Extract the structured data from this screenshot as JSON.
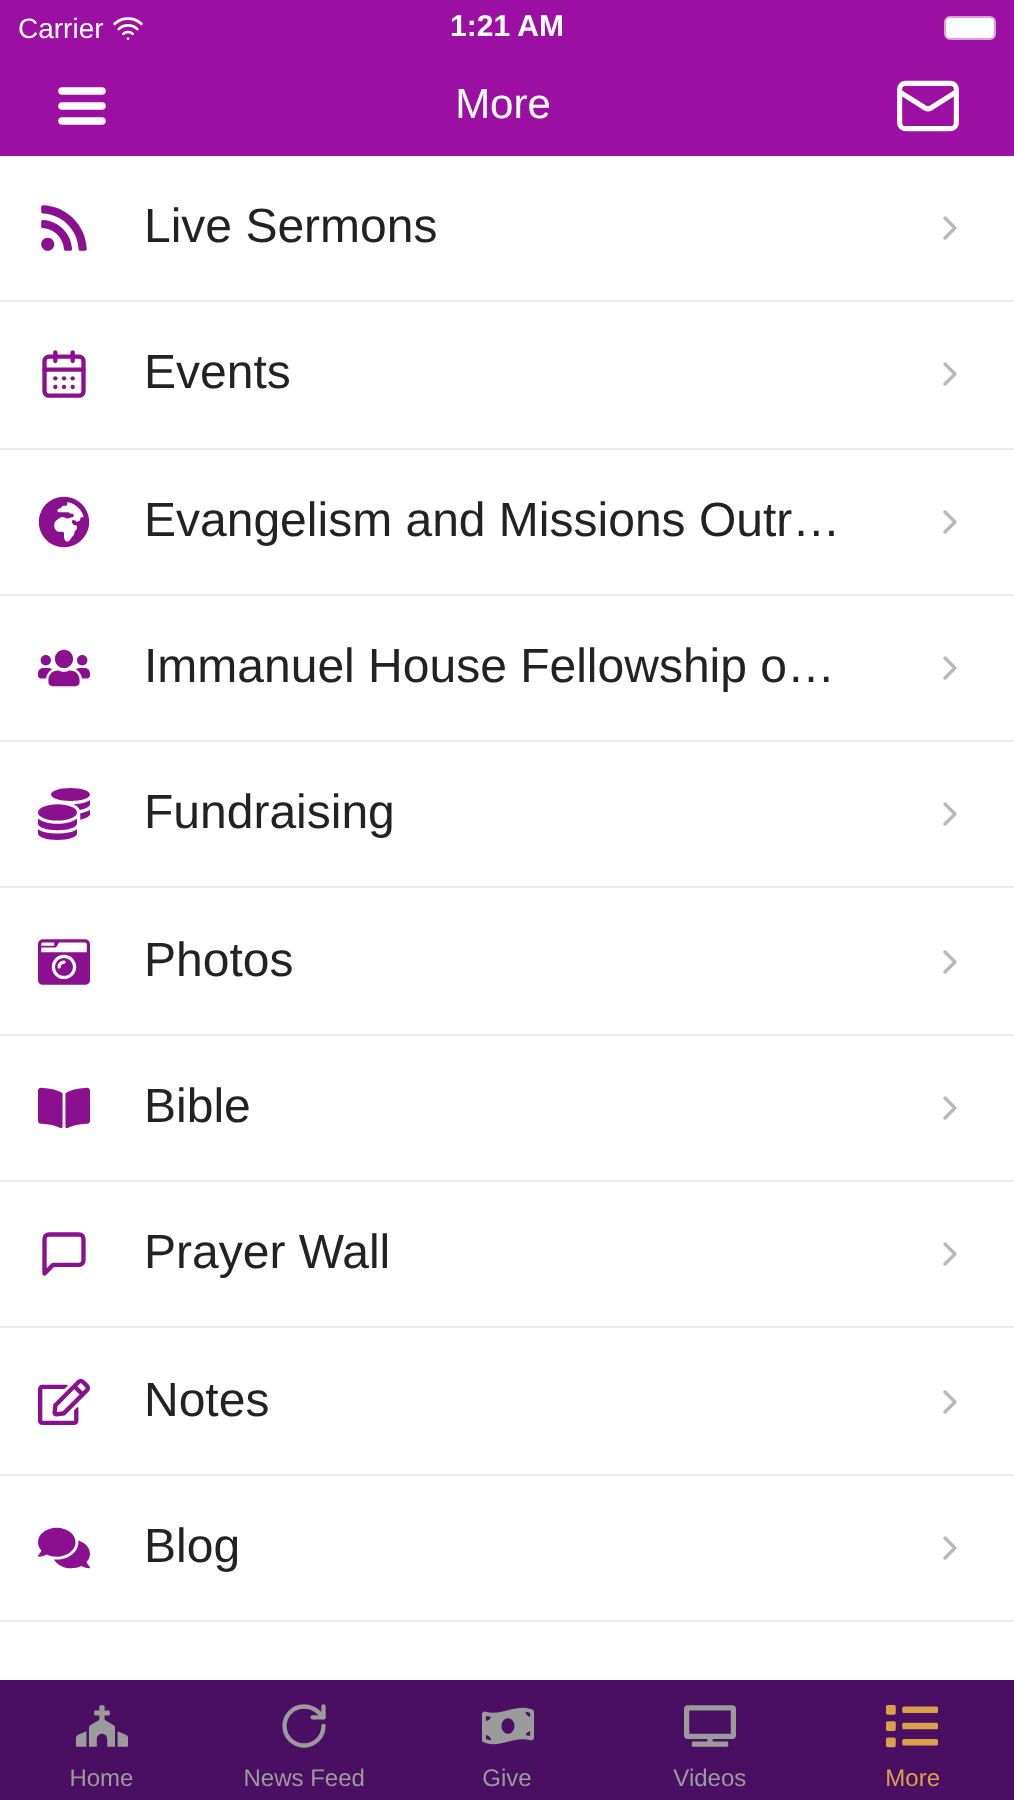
{
  "status_bar": {
    "carrier": "Carrier",
    "time": "1:21 AM"
  },
  "nav_bar": {
    "title": "More"
  },
  "menu_items": [
    {
      "label": "Live Sermons"
    },
    {
      "label": "Events"
    },
    {
      "label": "Evangelism and Missions Outr…"
    },
    {
      "label": "Immanuel House Fellowship o…"
    },
    {
      "label": "Fundraising"
    },
    {
      "label": "Photos"
    },
    {
      "label": "Bible"
    },
    {
      "label": "Prayer Wall"
    },
    {
      "label": "Notes"
    },
    {
      "label": "Blog"
    }
  ],
  "tab_bar": [
    {
      "label": "Home",
      "selected": false
    },
    {
      "label": "News Feed",
      "selected": false
    },
    {
      "label": "Give",
      "selected": false
    },
    {
      "label": "Videos",
      "selected": false
    },
    {
      "label": "More",
      "selected": true
    }
  ]
}
